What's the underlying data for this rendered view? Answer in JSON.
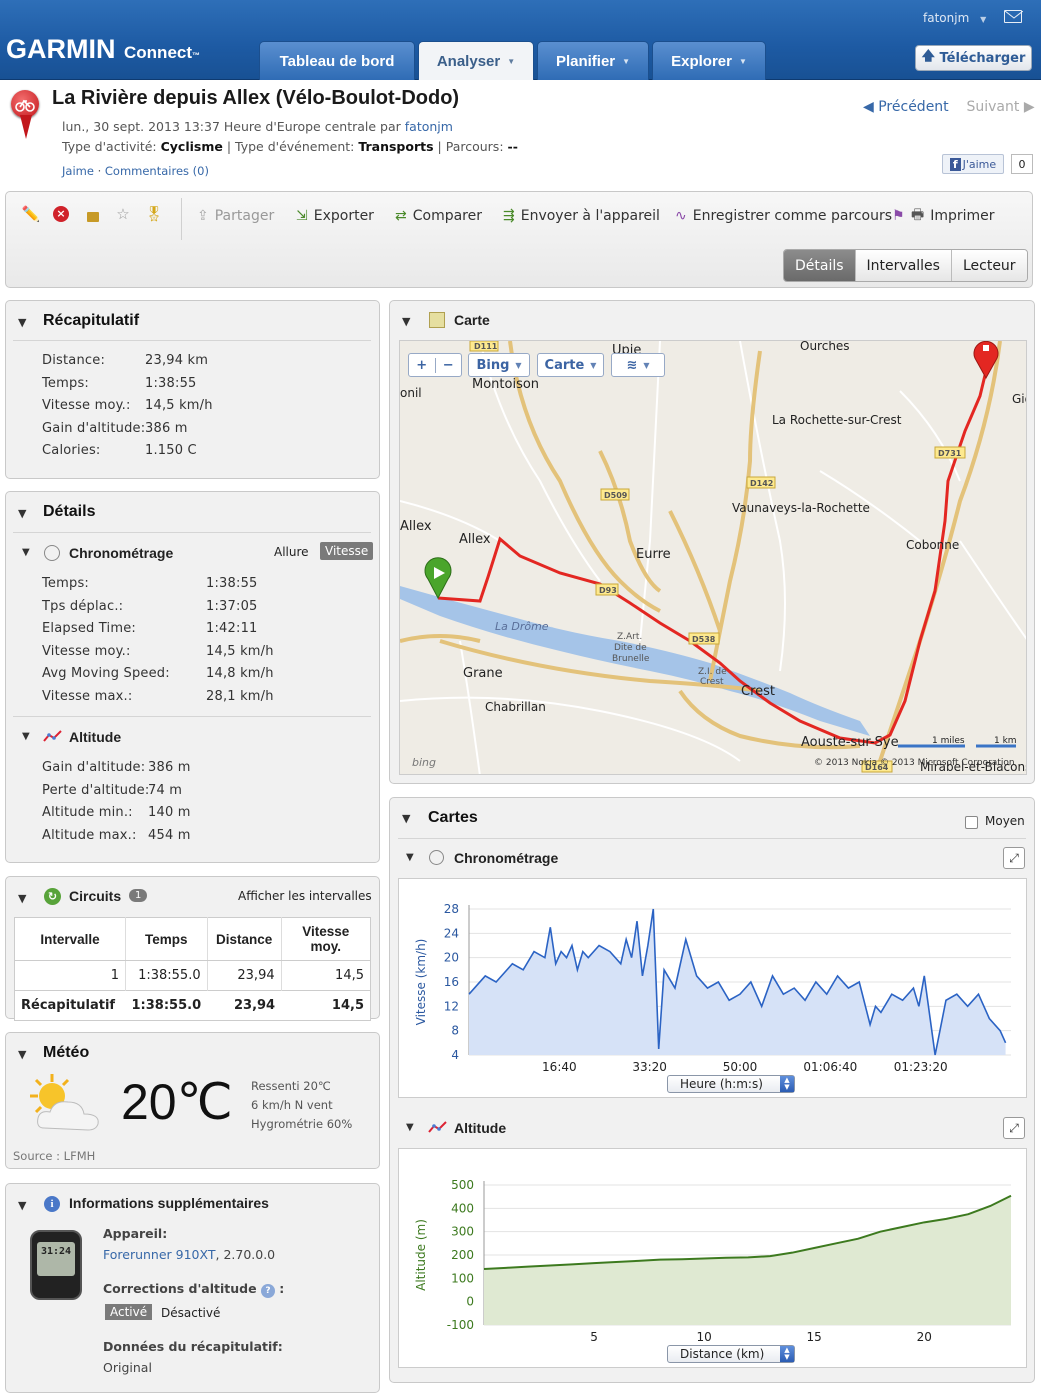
{
  "header": {
    "logo": "GARMIN",
    "logo_sub": "Connect",
    "logo_tm": "™",
    "user": "fatonjm",
    "tabs": [
      "Tableau de bord",
      "Analyser",
      "Planifier",
      "Explorer"
    ],
    "upload": "Télécharger"
  },
  "activity": {
    "title": "La Rivière depuis Allex (Vélo-Boulot-Dodo)",
    "date_prefix": "lun., 30 sept. 2013 13:37 Heure d'Europe centrale par ",
    "author": "fatonjm",
    "type_label": "Type d'activité: ",
    "type": "Cyclisme",
    "event_label": " | Type d'événement: ",
    "event": "Transports",
    "course_label": " | Parcours: ",
    "course": "--",
    "like": "Jaime",
    "comments": "Commentaires (0)",
    "prev": "Précédent",
    "next": "Suivant",
    "fb_like": "J'aime",
    "fb_count": "0"
  },
  "toolbar": {
    "share": "Partager",
    "export": "Exporter",
    "compare": "Comparer",
    "send": "Envoyer à l'appareil",
    "save_course": "Enregistrer comme parcours",
    "print": "Imprimer",
    "views": [
      "Détails",
      "Intervalles",
      "Lecteur"
    ]
  },
  "summary": {
    "title": "Récapitulatif",
    "rows": [
      {
        "k": "Distance:",
        "v": "23,94 km"
      },
      {
        "k": "Temps:",
        "v": "1:38:55"
      },
      {
        "k": "Vitesse moy.:",
        "v": "14,5 km/h"
      },
      {
        "k": "Gain d'altitude:",
        "v": "386 m"
      },
      {
        "k": "Calories:",
        "v": "1.150 C"
      }
    ]
  },
  "details": {
    "title": "Détails",
    "timing": {
      "title": "Chronométrage",
      "opt1": "Allure",
      "opt2": "Vitesse",
      "rows": [
        {
          "k": "Temps:",
          "v": "1:38:55"
        },
        {
          "k": "Tps déplac.:",
          "v": "1:37:05"
        },
        {
          "k": "Elapsed Time:",
          "v": "1:42:11"
        },
        {
          "k": "Vitesse moy.:",
          "v": "14,5 km/h"
        },
        {
          "k": "Avg Moving Speed:",
          "v": "14,8 km/h"
        },
        {
          "k": "Vitesse max.:",
          "v": "28,1 km/h"
        }
      ]
    },
    "altitude": {
      "title": "Altitude",
      "rows": [
        {
          "k": "Gain d'altitude:",
          "v": "386 m"
        },
        {
          "k": "Perte d'altitude:",
          "v": "74 m"
        },
        {
          "k": "Altitude min.:",
          "v": "140 m"
        },
        {
          "k": "Altitude max.:",
          "v": "454 m"
        }
      ]
    }
  },
  "laps": {
    "title": "Circuits",
    "count": "1",
    "show": "Afficher les intervalles",
    "headers": [
      "Intervalle",
      "Temps",
      "Distance",
      "Vitesse moy."
    ],
    "rows": [
      [
        "1",
        "1:38:55.0",
        "23,94",
        "14,5"
      ]
    ],
    "summary": [
      "Récapitulatif",
      "1:38:55.0",
      "23,94",
      "14,5"
    ]
  },
  "weather": {
    "title": "Météo",
    "temp": "20℃",
    "feels": "Ressenti 20℃",
    "wind": "6 km/h N vent",
    "humidity": "Hygrométrie 60%",
    "source": "Source : LFMH"
  },
  "extra": {
    "title": "Informations supplémentaires",
    "device_label": "Appareil:",
    "device": "Forerunner 910XT",
    "device_ver": ", 2.70.0.0",
    "corr_label": "Corrections d'altitude",
    "corr_on": "Activé",
    "corr_off": "Désactivé",
    "summary_label": "Données du récapitulatif:",
    "summary_val": "Original",
    "watch_time": "31:24"
  },
  "map": {
    "title": "Carte",
    "btn_bing": "Bing",
    "btn_carte": "Carte",
    "places": [
      "Ourches",
      "Upie",
      "Montoison",
      "onil",
      "La Rochette-sur-Crest",
      "Gig",
      "Vaunaveys-la-Rochette",
      "Allex",
      "Allex",
      "Eurre",
      "Cobonne",
      "La Drôme",
      "Z.Art. Dite de Brunelle",
      "Z.I. de Crest",
      "Grane",
      "Crest",
      "Chabrillan",
      "Aouste-sur-Sye",
      "Mirabel-et-Blacons"
    ],
    "roads": [
      "D111",
      "D731",
      "D142",
      "D509",
      "D93",
      "D538",
      "D164"
    ],
    "scale_mi": "1 miles",
    "scale_km": "1 km",
    "copyright": "© 2013 Nokia   © 2013 Microsoft Corporation",
    "bing": "bing"
  },
  "charts_section": {
    "title": "Cartes",
    "avg": "Moyen",
    "speed_title": "Chronométrage",
    "alt_title": "Altitude"
  },
  "chart_data": [
    {
      "type": "area",
      "title": "Chronométrage",
      "ylabel": "Vitesse (km/h)",
      "xlabel": "Heure (h:m:s)",
      "ylim": [
        4,
        28
      ],
      "yticks": [
        "4",
        "8",
        "12",
        "16",
        "20",
        "24",
        "28"
      ],
      "xticks": [
        "16:40",
        "33:20",
        "50:00",
        "01:06:40",
        "01:23:20"
      ],
      "color": "#2b63c4",
      "fill": "#d6e2f7",
      "x_min": [
        0,
        3,
        5,
        8,
        10,
        12,
        14,
        15,
        16,
        17,
        18,
        19,
        20,
        21,
        22,
        24,
        26,
        28,
        29,
        30,
        31,
        32,
        33,
        34,
        35,
        36,
        38,
        40,
        42,
        44,
        46,
        48,
        50,
        52,
        54,
        56,
        58,
        60,
        62,
        64,
        66,
        68,
        70,
        72,
        74,
        75,
        76,
        78,
        80,
        82,
        83,
        84,
        86,
        88,
        90,
        92,
        94,
        96,
        98,
        99
      ],
      "values": [
        14,
        17,
        16,
        19,
        18,
        21,
        20,
        25,
        19,
        21,
        20,
        22,
        18,
        21,
        20,
        22,
        21,
        19,
        23,
        20,
        26,
        17,
        22,
        28,
        5,
        18,
        15,
        23,
        17,
        15,
        16,
        13,
        14,
        16,
        12,
        17,
        14,
        15,
        13,
        16,
        14,
        17,
        15,
        16,
        9,
        12,
        11,
        14,
        13,
        15,
        12,
        17,
        4,
        13,
        14,
        12,
        14,
        10,
        8,
        6
      ]
    },
    {
      "type": "area",
      "title": "Altitude",
      "ylabel": "Altitude (m)",
      "xlabel": "Distance (km)",
      "ylim": [
        -100,
        500
      ],
      "yticks": [
        "-100",
        "0",
        "100",
        "200",
        "300",
        "400",
        "500"
      ],
      "xticks": [
        "5",
        "10",
        "15",
        "20"
      ],
      "color": "#3d7a1f",
      "fill": "#dfe9d2",
      "x": [
        0,
        1,
        2,
        3,
        4,
        5,
        6,
        7,
        8,
        9,
        10,
        11,
        12,
        13,
        14,
        15,
        16,
        17,
        18,
        19,
        20,
        21,
        22,
        23,
        23.94
      ],
      "values": [
        140,
        145,
        150,
        155,
        160,
        165,
        170,
        175,
        180,
        182,
        185,
        188,
        190,
        195,
        210,
        230,
        250,
        270,
        300,
        320,
        340,
        355,
        375,
        410,
        454
      ]
    }
  ]
}
